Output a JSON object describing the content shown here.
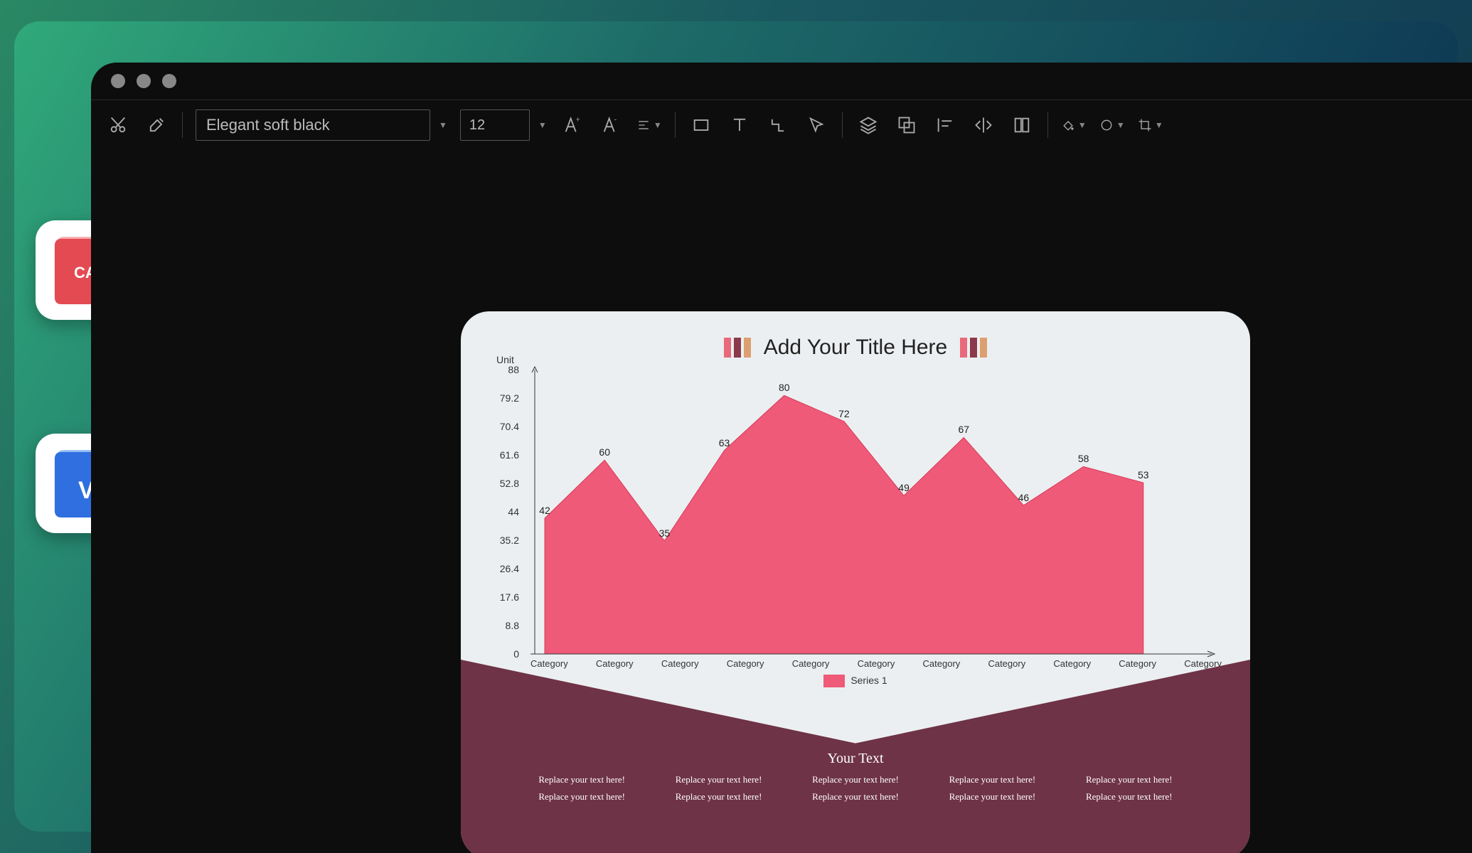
{
  "toolbar": {
    "font": "Elegant soft black",
    "size": "12"
  },
  "tiles": {
    "cad": "CAD",
    "v": "V"
  },
  "canvas": {
    "title": "Add Your Title Here",
    "yourText": "Your Text",
    "cells": [
      "Replace your text here!",
      "Replace your text here!",
      "Replace your text here!",
      "Replace your text here!",
      "Replace your text here!",
      "Replace your text here!",
      "Replace your text here!",
      "Replace your text here!",
      "Replace your text here!",
      "Replace your text here!"
    ]
  },
  "chart_data": {
    "type": "area",
    "title": "Add Your Title Here",
    "ylabel": "Unit",
    "ylim": [
      0,
      88
    ],
    "yticks": [
      0,
      8.8,
      17.6,
      26.4,
      35.2,
      44,
      52.8,
      61.6,
      70.4,
      79.2,
      88
    ],
    "categories": [
      "Category",
      "Category",
      "Category",
      "Category",
      "Category",
      "Category",
      "Category",
      "Category",
      "Category",
      "Category",
      "Category"
    ],
    "series": [
      {
        "name": "Series 1",
        "color": "#ef5a78",
        "values": [
          42,
          60,
          35,
          63,
          80,
          72,
          49,
          67,
          46,
          58,
          53
        ]
      }
    ]
  }
}
